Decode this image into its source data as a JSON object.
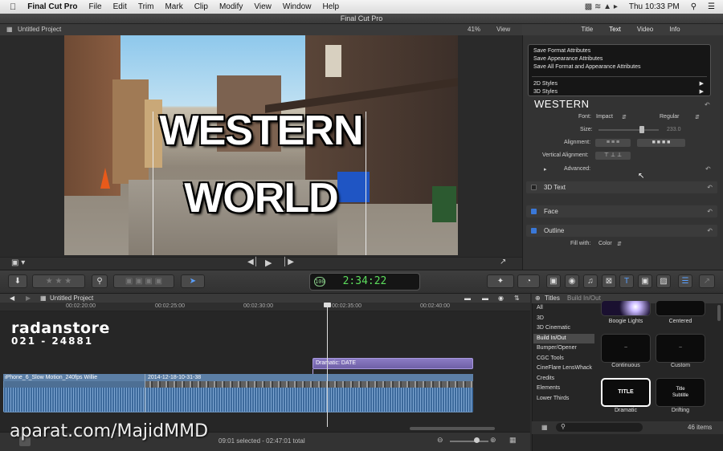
{
  "menubar": {
    "app": "Final Cut Pro",
    "items": [
      "File",
      "Edit",
      "Trim",
      "Mark",
      "Clip",
      "Modify",
      "View",
      "Window",
      "Help"
    ],
    "clock": "Thu 10:33 PM"
  },
  "window": {
    "title": "Final Cut Pro"
  },
  "viewer": {
    "project": "Untitled Project",
    "zoom": "41%",
    "view_menu": "View",
    "title_line1": "WESTERN",
    "title_line2": "WORLD"
  },
  "inspector": {
    "tabs": [
      "Title",
      "Text",
      "Video",
      "Info"
    ],
    "popup": {
      "items": [
        "Save Format Attributes",
        "Save Appearance Attributes",
        "Save All Format and Appearance Attributes"
      ],
      "submenus": [
        "2D Styles",
        "3D Styles"
      ]
    },
    "style_name": "WESTERN",
    "font_label": "Font:",
    "font_value": "Impact",
    "font_style": "Regular",
    "size_label": "Size:",
    "size_value": "233.0",
    "alignment_label": "Alignment:",
    "valign_label": "Vertical Alignment:",
    "advanced_label": "Advanced:",
    "sections": [
      "3D Text",
      "Face",
      "Outline"
    ],
    "fill_label": "Fill with:",
    "fill_value": "Color"
  },
  "toolbar": {
    "timecode": "2:34:22",
    "frame_label": "100"
  },
  "timeline": {
    "project": "Untitled Project",
    "ruler": [
      "00:02:20:00",
      "00:02:25:00",
      "00:02:30:00",
      "00:02:35:00",
      "00:02:40:00"
    ],
    "title_clip": "Dramatic: DATE",
    "clip1": "iPhone_6_Slow Motion_240fps Willie",
    "clip2": "2014-12-18-10-31-38"
  },
  "status": {
    "selection": "09:01 selected - 02:47:01 total"
  },
  "browser": {
    "header": "Titles",
    "category": "Build In/Out",
    "categories": [
      "All",
      "3D",
      "3D Cinematic",
      "Build In/Out",
      "Bumper/Opener",
      "CGC Tools",
      "CineFlare LensWhack",
      "Credits",
      "Elements",
      "Lower Thirds"
    ],
    "selected_category": "Build In/Out",
    "thumbs": [
      "Boogie Lights",
      "Centered",
      "Continuous",
      "Custom",
      "Dramatic",
      "Drifting"
    ],
    "thumb_text_title": "TITLE",
    "thumb_text_sub": "Title\nSubtitle",
    "count": "46 items"
  },
  "overlay": {
    "brand": "radanstore",
    "phone": "021 - 24881",
    "site": "aparat.com/MajidMMD"
  },
  "colors": {
    "accent": "#3a78d8",
    "clip": "#4d6f94",
    "title_clip": "#7b6bb8",
    "timecode": "#5cdc5c"
  }
}
